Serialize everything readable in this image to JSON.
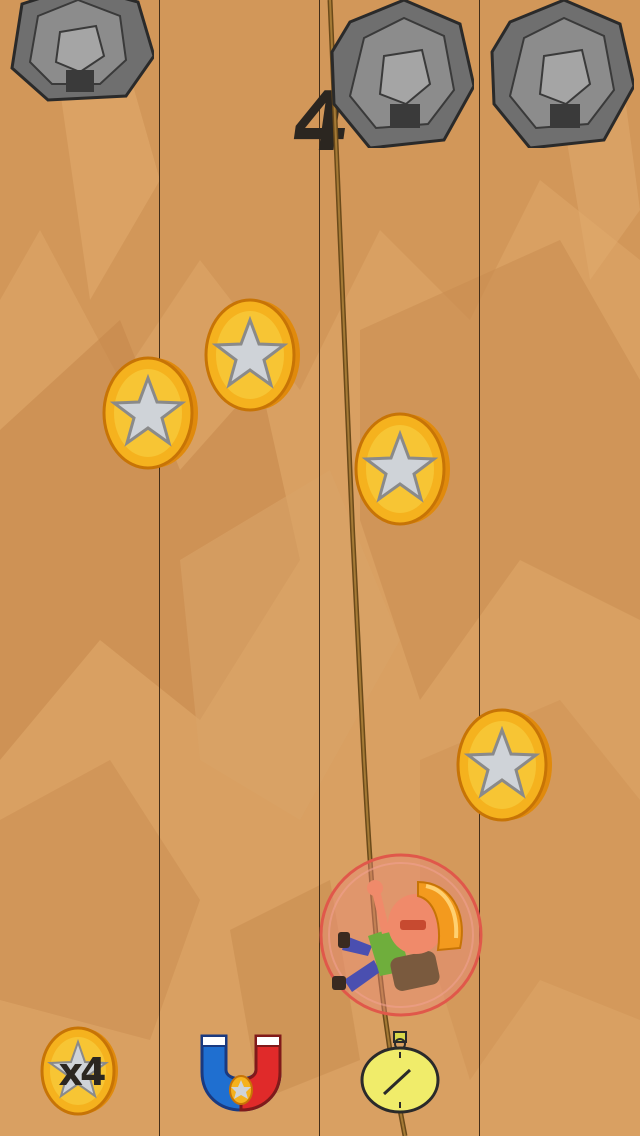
{
  "game": {
    "score": "4",
    "lanes": 4,
    "falling_rocks": [
      {
        "lane": 1,
        "icon": "rock-icon"
      },
      {
        "lane": 3,
        "icon": "rock-icon"
      },
      {
        "lane": 4,
        "icon": "rock-icon"
      }
    ],
    "coins": [
      {
        "icon": "star-coin-icon"
      },
      {
        "icon": "star-coin-icon"
      },
      {
        "icon": "star-coin-icon"
      },
      {
        "icon": "star-coin-icon"
      }
    ],
    "player": {
      "icon": "climber-icon",
      "shield_active": true
    }
  },
  "powerups": {
    "multiplier_label": "x4",
    "items": [
      {
        "name": "coin-multiplier",
        "icon": "x4-coin-icon"
      },
      {
        "name": "magnet",
        "icon": "magnet-icon"
      },
      {
        "name": "stopwatch",
        "icon": "stopwatch-icon"
      }
    ]
  },
  "colors": {
    "background": "#d49a5c",
    "background_shadow": "#c58a4e",
    "coin_gold": "#f5b21e",
    "coin_rim": "#e08a0c",
    "rope": "#6b4a1a",
    "shield": "#e0584a"
  }
}
